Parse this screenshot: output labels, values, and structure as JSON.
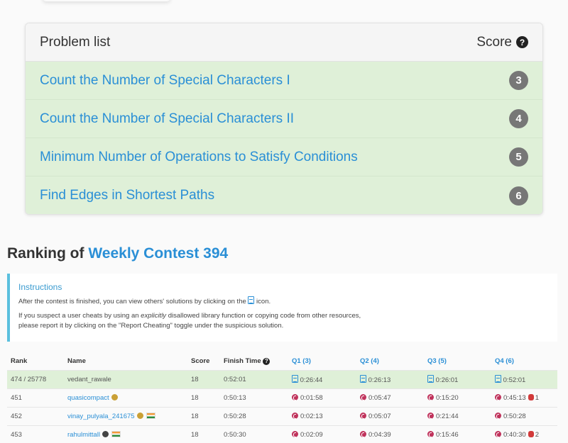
{
  "problem_panel": {
    "header_label": "Problem list",
    "score_label": "Score",
    "help_icon": "?",
    "problems": [
      {
        "title": "Count the Number of Special Characters I",
        "score": "3"
      },
      {
        "title": "Count the Number of Special Characters II",
        "score": "4"
      },
      {
        "title": "Minimum Number of Operations to Satisfy Conditions",
        "score": "5"
      },
      {
        "title": "Find Edges in Shortest Paths",
        "score": "6"
      }
    ]
  },
  "ranking": {
    "prefix": "Ranking of",
    "contest": "Weekly Contest 394"
  },
  "instructions": {
    "title": "Instructions",
    "line1_before": "After the contest is finished, you can view others' solutions by clicking on the",
    "line1_after": "icon.",
    "line2_before": "If you suspect a user cheats by using an",
    "line2_em": "explicitly",
    "line2_after": "disallowed library function or copying code from other resources,",
    "line3": "please report it by clicking on the \"Report Cheating\" toggle under the suspicious solution."
  },
  "table": {
    "headers": {
      "rank": "Rank",
      "name": "Name",
      "score": "Score",
      "finish": "Finish Time",
      "q1": "Q1 (3)",
      "q2": "Q2 (4)",
      "q3": "Q3 (5)",
      "q4": "Q4 (6)"
    },
    "rows": [
      {
        "rank": "474 / 25778",
        "name": "vedant_rawale",
        "score": "18",
        "finish": "0:52:01",
        "q1": "0:26:44",
        "q2": "0:26:13",
        "q3": "0:26:01",
        "q4": "0:52:01",
        "q4_penalty": ""
      },
      {
        "rank": "451",
        "name": "quasicompact",
        "score": "18",
        "finish": "0:50:13",
        "q1": "0:01:58",
        "q2": "0:05:47",
        "q3": "0:15:20",
        "q4": "0:45:13",
        "q4_penalty": "1"
      },
      {
        "rank": "452",
        "name": "vinay_pulyala_241675",
        "score": "18",
        "finish": "0:50:28",
        "q1": "0:02:13",
        "q2": "0:05:07",
        "q3": "0:21:44",
        "q4": "0:50:28",
        "q4_penalty": ""
      },
      {
        "rank": "453",
        "name": "rahulmittall",
        "score": "18",
        "finish": "0:50:30",
        "q1": "0:02:09",
        "q2": "0:04:39",
        "q3": "0:15:46",
        "q4": "0:40:30",
        "q4_penalty": "2"
      }
    ]
  }
}
